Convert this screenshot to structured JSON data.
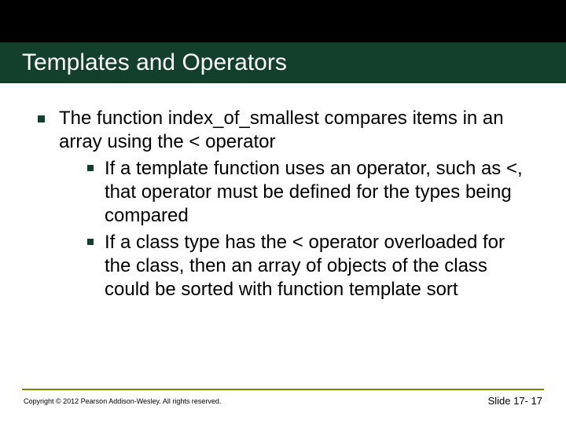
{
  "title": "Templates and Operators",
  "bullet1": "The function index_of_smallest compares items in an array using the < operator",
  "sub1": "If a template function uses an operator, such as <, that operator must be defined for the types being compared",
  "sub2": "If a class type has the < operator overloaded for the class, then an array of objects of the class could be sorted with function template sort",
  "copyright": "Copyright © 2012 Pearson Addison-Wesley. All rights reserved.",
  "slidenum": "Slide 17- 17"
}
